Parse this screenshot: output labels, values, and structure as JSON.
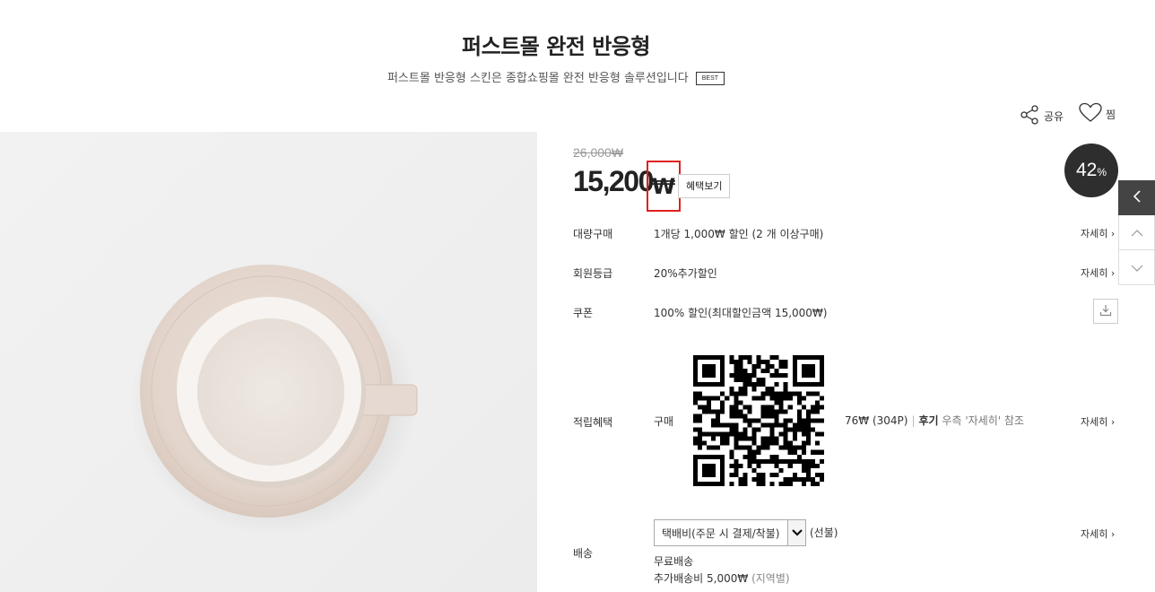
{
  "product": {
    "title": "퍼스트몰 완전 반응형",
    "subtitle": "퍼스트몰 반응형 스킨은 종합쇼핑몰 완전 반응형 솔루션입니다",
    "badge": "BEST"
  },
  "actions": {
    "share_label": "공유",
    "wish_label": "찜"
  },
  "price": {
    "original": "26,000₩",
    "sale": "15,200",
    "currency": "₩",
    "benefit_button": "혜택보기",
    "discount_percent": "42",
    "discount_unit": "%"
  },
  "rows": {
    "bulk": {
      "label": "대량구매",
      "value": "1개당 1,000₩ 할인 (2 개 이상구매)",
      "detail": "자세히 ›"
    },
    "member": {
      "label": "회원등급",
      "value": "20%추가할인",
      "detail": "자세히 ›"
    },
    "coupon": {
      "label": "쿠폰",
      "value": "100% 할인(최대할인금액 15,000₩)"
    },
    "points": {
      "label": "적립혜택",
      "purchase_label": "구매",
      "amount": "76₩ (304P)",
      "separator": "|",
      "review_label": "후기",
      "review_note": "우측 '자세히' 참조",
      "detail": "자세히 ›"
    },
    "shipping": {
      "label": "배송",
      "selected_option": "택배비(주문 시 결제/착불)",
      "prepaid": "(선불)",
      "free": "무료배송",
      "extra_label": "추가배송비 5,000₩",
      "extra_note": "(지역별)",
      "detail": "자세히 ›"
    }
  }
}
